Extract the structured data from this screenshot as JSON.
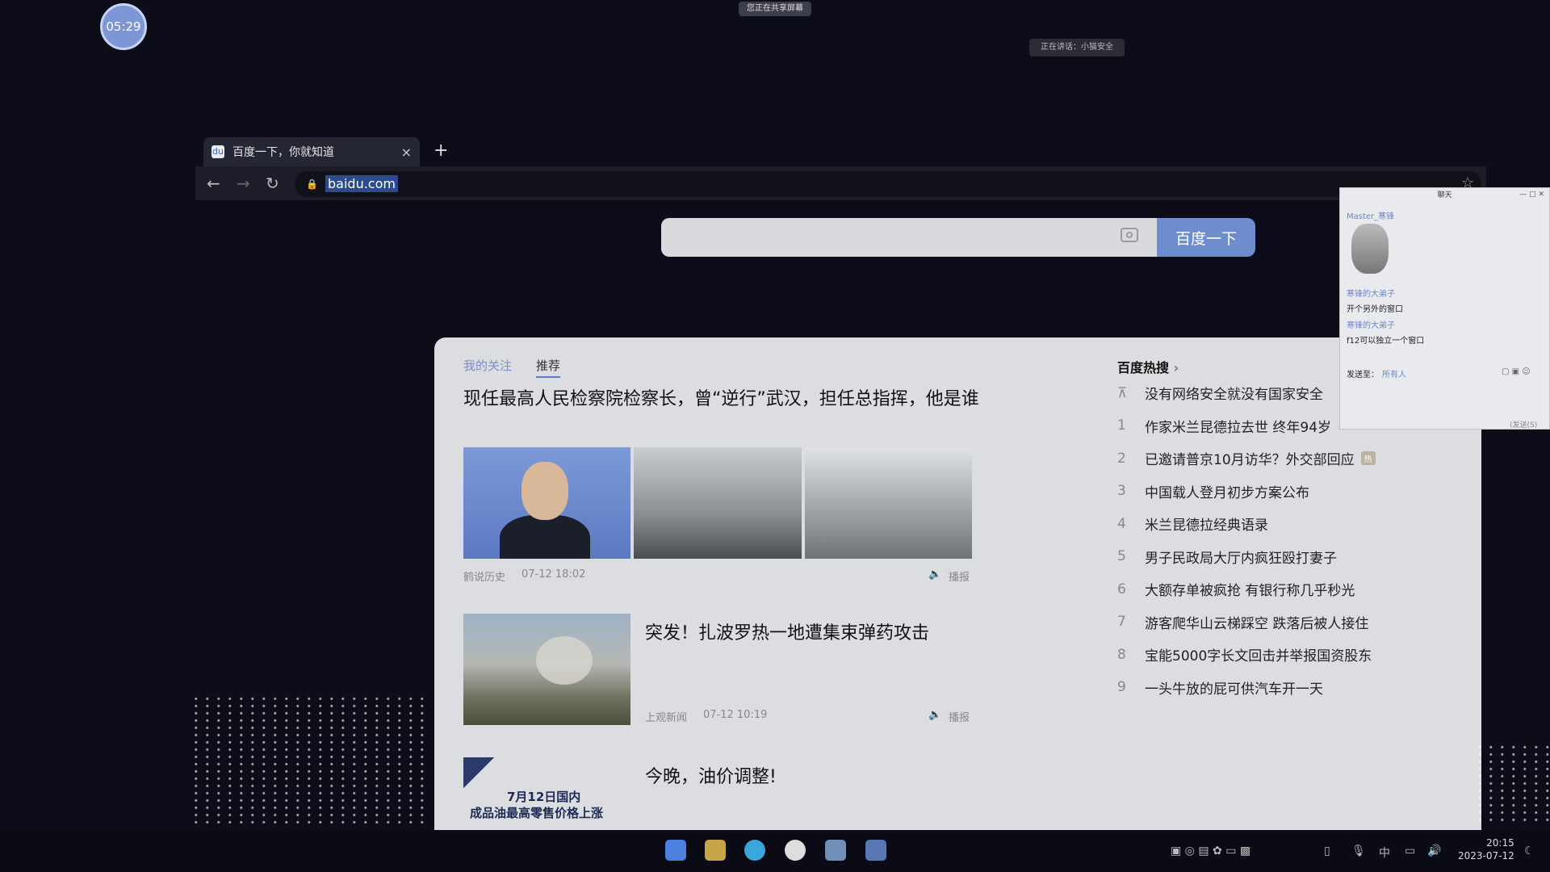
{
  "screen": {
    "recording_timer": "05:29",
    "share_indicator": "您正在共享屏幕",
    "meeting_status": "正在讲话：小猫安全"
  },
  "browser": {
    "tab_title": "百度一下，你就知道",
    "tab_close": "×",
    "new_tab": "+",
    "url": "baidu.com"
  },
  "baidu": {
    "search_placeholder": "",
    "search_button": "百度一下",
    "feed_tabs": [
      "我的关注",
      "推荐"
    ],
    "articles": [
      {
        "title": "现任最高人民检察院检察长，曾“逆行”武汉，担任总指挥，他是谁",
        "source": "鹤说历史",
        "time": "07-12 18:02",
        "broadcast": "播报"
      },
      {
        "title": "突发！扎波罗热一地遭集束弹药攻击",
        "source": "上观新闻",
        "time": "07-12 10:19",
        "broadcast": "播报"
      },
      {
        "title": "今晚，油价调整!",
        "image_text_line1": "7月12日国内",
        "image_text_line2": "成品油最高零售价格上涨"
      }
    ],
    "hot_search": {
      "title": "百度热搜",
      "items": [
        {
          "rank": "⊼",
          "text": "没有网络安全就没有国家安全",
          "badge": ""
        },
        {
          "rank": "1",
          "text": "作家米兰昆德拉去世 终年94岁",
          "badge": ""
        },
        {
          "rank": "2",
          "text": "已邀请普京10月访华？外交部回应",
          "badge": "热"
        },
        {
          "rank": "3",
          "text": "中国载人登月初步方案公布",
          "badge": ""
        },
        {
          "rank": "4",
          "text": "米兰昆德拉经典语录",
          "badge": ""
        },
        {
          "rank": "5",
          "text": "男子民政局大厅内疯狂殴打妻子",
          "badge": ""
        },
        {
          "rank": "6",
          "text": "大额存单被疯抢 有银行称几乎秒光",
          "badge": ""
        },
        {
          "rank": "7",
          "text": "游客爬华山云梯踩空 跌落后被人接住",
          "badge": ""
        },
        {
          "rank": "8",
          "text": "宝能5000字长文回击并举报国资股东",
          "badge": ""
        },
        {
          "rank": "9",
          "text": "一头牛放的屁可供汽车开一天",
          "badge": ""
        }
      ]
    }
  },
  "chat": {
    "title": "聊天",
    "host": "Master_寒锋",
    "messages": [
      {
        "sender": "寒锋的大弟子",
        "text": "开个另外的窗口"
      },
      {
        "sender": "寒锋的大弟子",
        "text": "f12可以独立一个窗口"
      }
    ],
    "send_to_label": "发送至：",
    "send_to_value": "所有人",
    "footer": "(发送(S)"
  },
  "taskbar": {
    "ime": "中",
    "time": "20:15",
    "date": "2023-07-12"
  }
}
